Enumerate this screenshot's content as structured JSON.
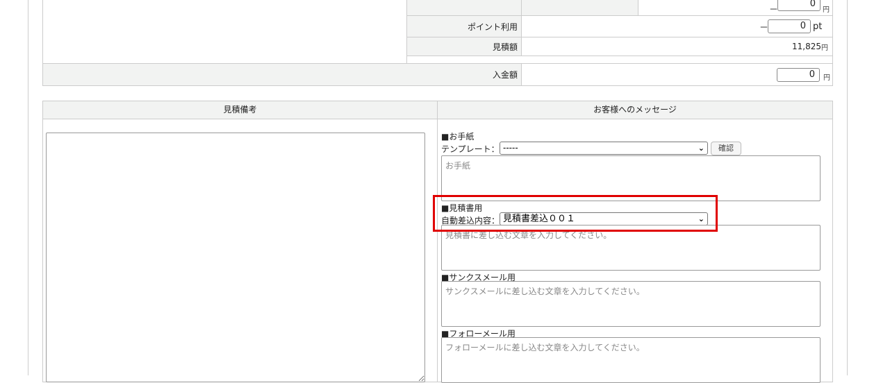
{
  "totals": {
    "row1": {
      "value": "0",
      "unit": "円",
      "sign": "－"
    },
    "points": {
      "label": "ポイント利用",
      "value": "0",
      "unit": "pt",
      "sign": "－"
    },
    "estimate": {
      "label": "見積額",
      "value": "11,825",
      "unit": "円"
    },
    "deposit": {
      "label": "入金額",
      "value": "0",
      "unit": "円"
    }
  },
  "notes": {
    "header": "見積備考",
    "value": ""
  },
  "message": {
    "header": "お客様へのメッセージ",
    "letter": {
      "title": "■お手紙",
      "template_label": "テンプレート：",
      "template_value": "-----",
      "confirm_label": "確認",
      "placeholder": "お手紙"
    },
    "estimate_doc": {
      "title": "■見積書用",
      "auto_label": "自動差込内容：",
      "auto_value": "見積書差込００１",
      "placeholder": "見積書に差し込む文章を入力してください。"
    },
    "thanks": {
      "title": "■サンクスメール用",
      "placeholder": "サンクスメールに差し込む文章を入力してください。"
    },
    "follow": {
      "title": "■フォローメール用",
      "placeholder": "フォローメールに差し込む文章を入力してください。"
    }
  },
  "highlight_color": "#e00000"
}
